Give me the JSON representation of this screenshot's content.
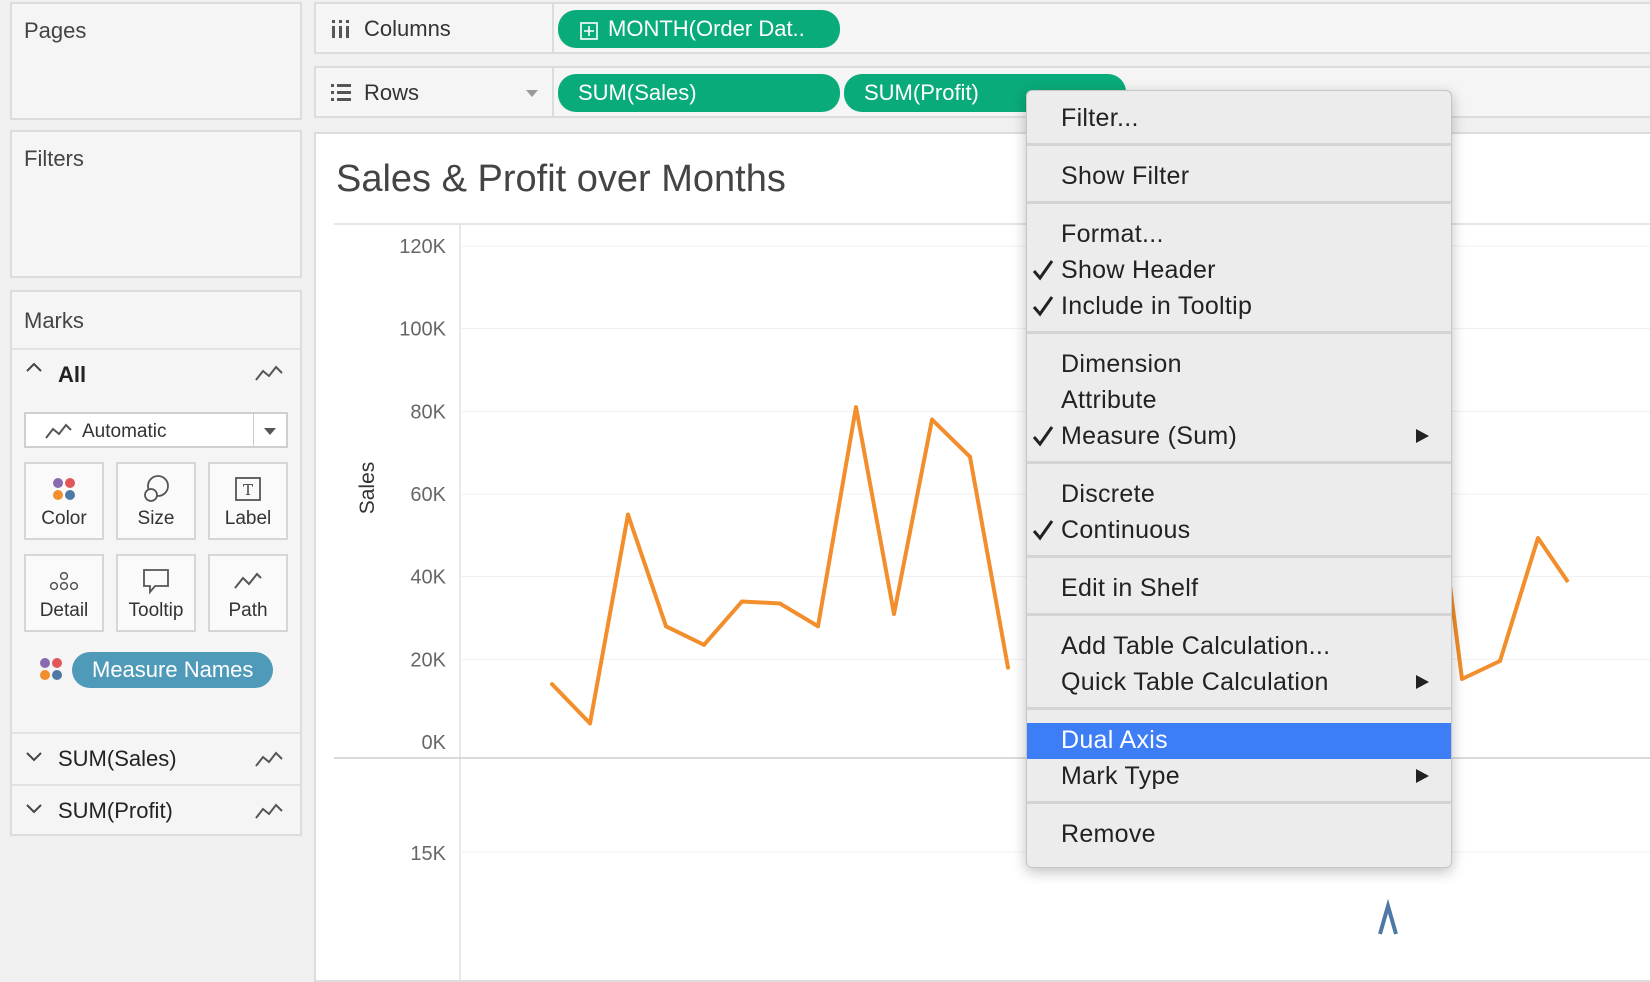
{
  "pages": {
    "title": "Pages"
  },
  "filters": {
    "title": "Filters"
  },
  "marks": {
    "title": "Marks",
    "all_label": "All",
    "mark_type": "Automatic",
    "tiles": [
      {
        "label": "Color",
        "icon": "color-dots-icon"
      },
      {
        "label": "Size",
        "icon": "size-circles-icon"
      },
      {
        "label": "Label",
        "icon": "text-label-icon"
      },
      {
        "label": "Detail",
        "icon": "detail-dots-icon"
      },
      {
        "label": "Tooltip",
        "icon": "speech-bubble-icon"
      },
      {
        "label": "Path",
        "icon": "path-line-icon"
      }
    ],
    "measure_names_pill": "Measure Names",
    "cards": [
      "SUM(Sales)",
      "SUM(Profit)"
    ]
  },
  "shelves": {
    "columns_label": "Columns",
    "rows_label": "Rows",
    "columns_pills": [
      "MONTH(Order Dat.."
    ],
    "rows_pills": [
      "SUM(Sales)",
      "SUM(Profit)"
    ]
  },
  "view": {
    "title": "Sales & Profit over Months",
    "y_axis_label": "Sales",
    "sales_ticks": [
      "120K",
      "100K",
      "80K",
      "60K",
      "40K",
      "20K",
      "0K"
    ],
    "profit_tick": "15K",
    "line_color": "#f28e2b",
    "profit_line_color": "#4e79a7"
  },
  "chart_data": {
    "type": "line",
    "series": [
      {
        "name": "SUM(Sales)",
        "values": [
          14000,
          4500,
          55000,
          28000,
          23500,
          34000,
          33500,
          28000,
          81000,
          31000,
          78000,
          69000,
          18000
        ]
      }
    ],
    "ylabel": "Sales",
    "ylim": [
      0,
      125000
    ]
  },
  "context_menu": {
    "items": [
      {
        "label": "Filter...",
        "checked": false,
        "submenu": false
      },
      {
        "sep": true
      },
      {
        "label": "Show Filter",
        "checked": false,
        "submenu": false
      },
      {
        "sep": true
      },
      {
        "label": "Format...",
        "checked": false,
        "submenu": false
      },
      {
        "label": "Show Header",
        "checked": true,
        "submenu": false
      },
      {
        "label": "Include in Tooltip",
        "checked": true,
        "submenu": false
      },
      {
        "sep": true
      },
      {
        "label": "Dimension",
        "checked": false,
        "submenu": false
      },
      {
        "label": "Attribute",
        "checked": false,
        "submenu": false
      },
      {
        "label": "Measure (Sum)",
        "checked": true,
        "submenu": true
      },
      {
        "sep": true
      },
      {
        "label": "Discrete",
        "checked": false,
        "submenu": false
      },
      {
        "label": "Continuous",
        "checked": true,
        "submenu": false
      },
      {
        "sep": true
      },
      {
        "label": "Edit in Shelf",
        "checked": false,
        "submenu": false
      },
      {
        "sep": true
      },
      {
        "label": "Add Table Calculation...",
        "checked": false,
        "submenu": false
      },
      {
        "label": "Quick Table Calculation",
        "checked": false,
        "submenu": true
      },
      {
        "sep": true
      },
      {
        "label": "Dual Axis",
        "checked": false,
        "submenu": false,
        "highlighted": true
      },
      {
        "label": "Mark Type",
        "checked": false,
        "submenu": true
      },
      {
        "sep": true
      },
      {
        "label": "Remove",
        "checked": false,
        "submenu": false
      }
    ],
    "highlight_color": "#3d7ef6"
  }
}
